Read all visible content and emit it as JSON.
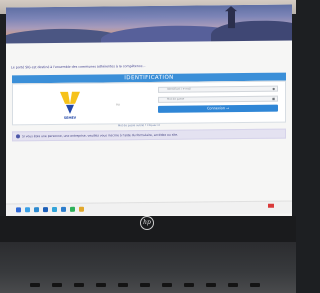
{
  "header": {
    "intro_text": "Le porté SIG est destiné à l'ensemble des communes adhérentes à la compétence..."
  },
  "identification": {
    "title": "IDENTIFICATION",
    "logo_text": "SEMEV",
    "separator_text": "ou",
    "username_placeholder": "Identifiant / e-mail",
    "password_placeholder": "Mot de passe",
    "login_button": "Connexion →",
    "forgot_link": "Mot de passe oublié ? Cliquez ici"
  },
  "notice": {
    "text": "Si vous êtes une personne, une entreprise, veuillez vous inscrire à l'aide du formulaire, accédez au site."
  },
  "laptop": {
    "brand_logo": "hp"
  },
  "colors": {
    "header_blue": "#3b8fd8",
    "button_blue": "#2f86d6",
    "notice_lilac": "#e4e2f1",
    "logo_yellow": "#f6c21a",
    "logo_blue": "#2348a8"
  },
  "icons": [
    "user-icon",
    "lock-icon",
    "arrow-right-icon",
    "info-icon"
  ]
}
